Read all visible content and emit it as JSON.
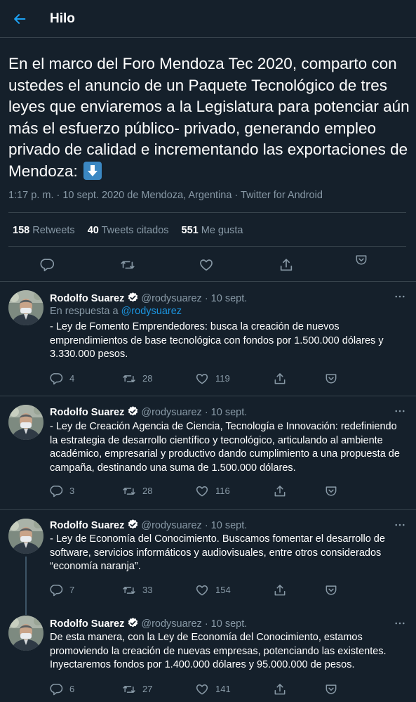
{
  "header": {
    "title": "Hilo"
  },
  "main_tweet": {
    "text": "En el marco del Foro Mendoza Tec 2020, comparto con ustedes el anuncio de un Paquete Tecnológico de tres leyes que enviaremos a la Legislatura para potenciar aún más el esfuerzo público- privado, generando empleo privado de calidad e incrementando las exportaciones de Mendoza:",
    "emoji": "down-arrow-emoji",
    "meta": "1:17 p. m. · 10 sept. 2020 de Mendoza, Argentina · Twitter for Android",
    "stats": {
      "retweets_count": "158",
      "retweets_label": "Retweets",
      "quotes_count": "40",
      "quotes_label": "Tweets citados",
      "likes_count": "551",
      "likes_label": "Me gusta"
    }
  },
  "tweets": [
    {
      "name": "Rodolfo Suarez",
      "handle": "@rodysuarez",
      "date": "· 10 sept.",
      "reply_prefix": "En respuesta a",
      "reply_to": "@rodysuarez",
      "text": "- Ley de Fomento Emprendedores: busca la creación de nuevos emprendimientos de base tecnológica con fondos por 1.500.000 dólares y 3.330.000 pesos.",
      "replies": "4",
      "retweets": "28",
      "likes": "119"
    },
    {
      "name": "Rodolfo Suarez",
      "handle": "@rodysuarez",
      "date": "· 10 sept.",
      "text": "- Ley de Creación Agencia de Ciencia, Tecnología e Innovación: redefiniendo la estrategia de desarrollo científico y tecnológico, articulando al ambiente académico, empresarial y productivo dando cumplimiento a una propuesta de campaña, destinando una suma de 1.500.000 dólares.",
      "replies": "3",
      "retweets": "28",
      "likes": "116"
    },
    {
      "name": "Rodolfo Suarez",
      "handle": "@rodysuarez",
      "date": "· 10 sept.",
      "text": "- Ley de Economía del Conocimiento. Buscamos fomentar el desarrollo de software, servicios informáticos y audiovisuales, entre otros considerados “economía naranja”.",
      "replies": "7",
      "retweets": "33",
      "likes": "154"
    },
    {
      "name": "Rodolfo Suarez",
      "handle": "@rodysuarez",
      "date": "· 10 sept.",
      "text": "De esta manera, con la Ley de Economía del Conocimiento, estamos promoviendo la creación de nuevas empresas, potenciando las existentes. Inyectaremos fondos por 1.400.000 dólares y 95.000.000 de pesos.",
      "replies": "6",
      "retweets": "27",
      "likes": "141"
    }
  ],
  "colors": {
    "background": "#15202b",
    "divider": "#38444d",
    "accent": "#1da1f2",
    "muted_text": "#8899a6",
    "text": "#ffffff"
  }
}
